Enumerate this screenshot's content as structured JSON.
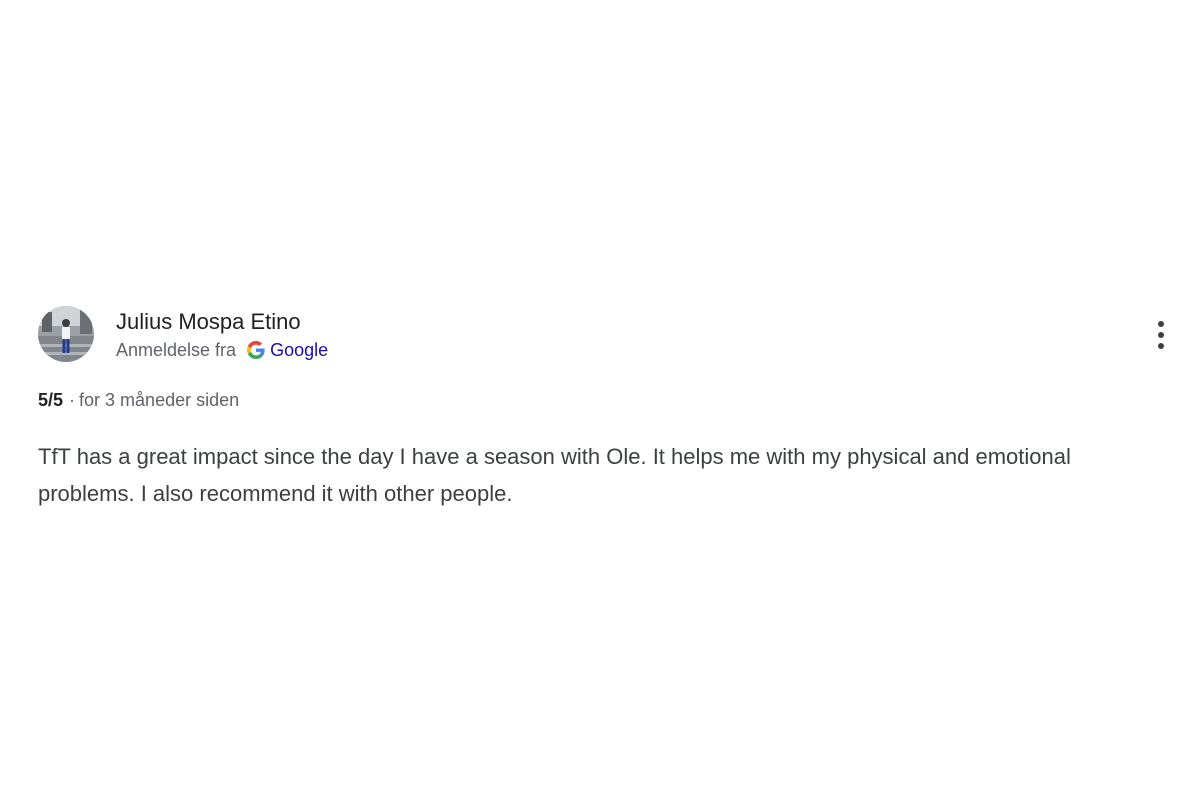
{
  "review": {
    "author": "Julius Mospa Etino",
    "source_label": "Anmeldelse fra",
    "source_name": "Google",
    "source_icon": "google-g-icon",
    "rating": "5/5",
    "separator": "·",
    "time": "for 3 måneder siden",
    "text": "TfT has a great impact since the day I have a season with Ole. It helps me with my physical and emotional problems. I also recommend it with other people.",
    "more_icon": "more-vertical-icon"
  },
  "colors": {
    "author": "#202124",
    "muted": "#5f6368",
    "link": "#1a0dab",
    "body_text": "#3c4043"
  }
}
